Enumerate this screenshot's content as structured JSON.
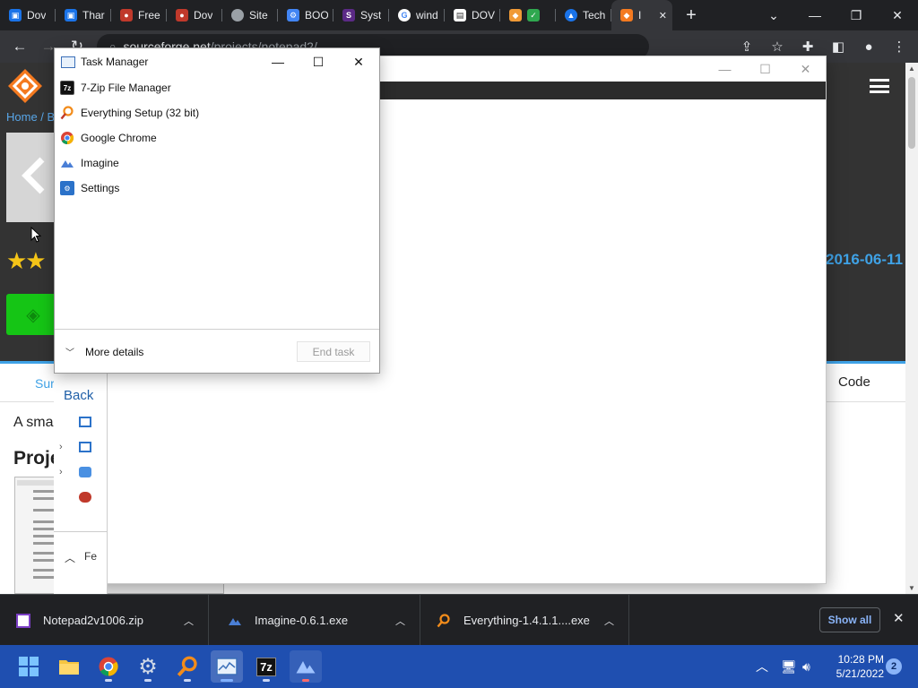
{
  "browser": {
    "tabs": [
      {
        "label": "Dov",
        "color": "#1a73e8"
      },
      {
        "label": "Thar",
        "color": "#1a73e8"
      },
      {
        "label": "Free",
        "color": "#e34c26"
      },
      {
        "label": "Dov",
        "color": "#e34c26"
      },
      {
        "label": "Site",
        "color": "#9aa0a6"
      },
      {
        "label": "BOO",
        "color": "#4285f4"
      },
      {
        "label": "Syst",
        "color": "#5b2a86"
      },
      {
        "label": "wind",
        "color": "#ffffff"
      },
      {
        "label": "DOV",
        "color": "#ffffff"
      },
      {
        "label": "",
        "color": "#f09a36"
      },
      {
        "label": "Tech",
        "color": "#1a73e8"
      },
      {
        "label": "I",
        "color": "#f47a20"
      }
    ],
    "url_host": "sourceforge.net",
    "url_path": "/projects/notepad2/"
  },
  "page": {
    "breadcrumb": "Home / Br",
    "date": "2016-06-11",
    "support_tab": "Sur",
    "code_tab": "Code",
    "description": "A smal",
    "project_heading": "Proje"
  },
  "blank_window": {
    "minimize": "—",
    "maximize": "☐",
    "close": "✕"
  },
  "file_manager": {
    "back": "Back",
    "footer_label": "Fe"
  },
  "task_manager": {
    "title": "Task Manager",
    "apps": [
      {
        "name": "7-Zip File Manager",
        "icon": "7zip-icon",
        "color": "#111111"
      },
      {
        "name": "Everything Setup (32 bit)",
        "icon": "everything-icon",
        "color": "#f28c1b"
      },
      {
        "name": "Google Chrome",
        "icon": "chrome-icon",
        "color": "#4285f4"
      },
      {
        "name": "Imagine",
        "icon": "imagine-icon",
        "color": "#4a7fd6"
      },
      {
        "name": "Settings",
        "icon": "settings-icon",
        "color": "#2b72c9"
      }
    ],
    "more_details": "More details",
    "end_task": "End task"
  },
  "downloads": {
    "items": [
      {
        "name": "Notepad2v1006.zip",
        "icon": "zip-icon"
      },
      {
        "name": "Imagine-0.6.1.exe",
        "icon": "imagine-icon"
      },
      {
        "name": "Everything-1.4.1.1....exe",
        "icon": "everything-icon"
      }
    ],
    "show_all": "Show all"
  },
  "taskbar": {
    "time": "10:28 PM",
    "date": "5/21/2022",
    "notifications": "2"
  },
  "colors": {
    "taskbar": "#1f4fb0",
    "sourceforge_orange": "#f47a20",
    "link_blue": "#3fa2e6",
    "download_green": "#15c515"
  }
}
